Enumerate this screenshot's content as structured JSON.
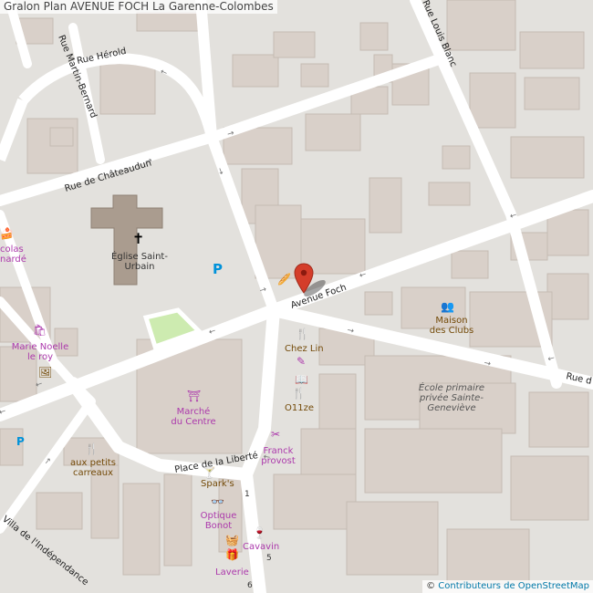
{
  "title": "Gralon Plan AVENUE FOCH La Garenne-Colombes",
  "attribution": {
    "prefix": "©",
    "link": "Contributeurs de OpenStreetMap"
  },
  "colors": {
    "background": "#e3e1dd",
    "road": "#ffffff",
    "building": "#d9d0c9",
    "church": "#aa9c8f",
    "park": "#cdebb0",
    "poi_purple": "#ac39ac",
    "poi_brown": "#734a08",
    "parking": "#0092da",
    "pin": "#d43d2a"
  },
  "streets": {
    "avenue_foch": "Avenue Foch",
    "rue_herold": "Rue Hérold",
    "rue_martin_bernard": "Rue Martin-Bernard",
    "rue_chateaudun": "Rue de Châteaudun",
    "rue_louis_blanc": "Rue Louis Blanc",
    "place_liberte": "Place de la Liberté",
    "villa_independance": "Villa de l'Indépendance",
    "rue_d": "Rue d"
  },
  "pois": {
    "eglise": "Église Saint-Urbain",
    "eglise_line1": "Église Saint-",
    "eglise_line2": "Urbain",
    "marche_line1": "Marché",
    "marche_line2": "du Centre",
    "maison_line1": "Maison",
    "maison_line2": "des Clubs",
    "ecole_line1": "École primaire",
    "ecole_line2": "privée Sainte-",
    "ecole_line3": "Geneviève",
    "chez_lin": "Chez Lin",
    "o11ze": "O11ze",
    "franck_line1": "Franck",
    "franck_line2": "provost",
    "sparks": "Spark's",
    "optique_line1": "Optique",
    "optique_line2": "Bonot",
    "cavavin": "Cavavin",
    "laverie": "Laverie",
    "aux_petits_line1": "aux petits",
    "aux_petits_line2": "carreaux",
    "marie_noelle_line1": "Marie Noelle",
    "marie_noelle_line2": "le roy",
    "colas_line1": "colas",
    "colas_line2": "nardé",
    "parking_symbol": "P"
  },
  "house_numbers": {
    "n1": "1",
    "n5": "5",
    "n6": "6"
  }
}
